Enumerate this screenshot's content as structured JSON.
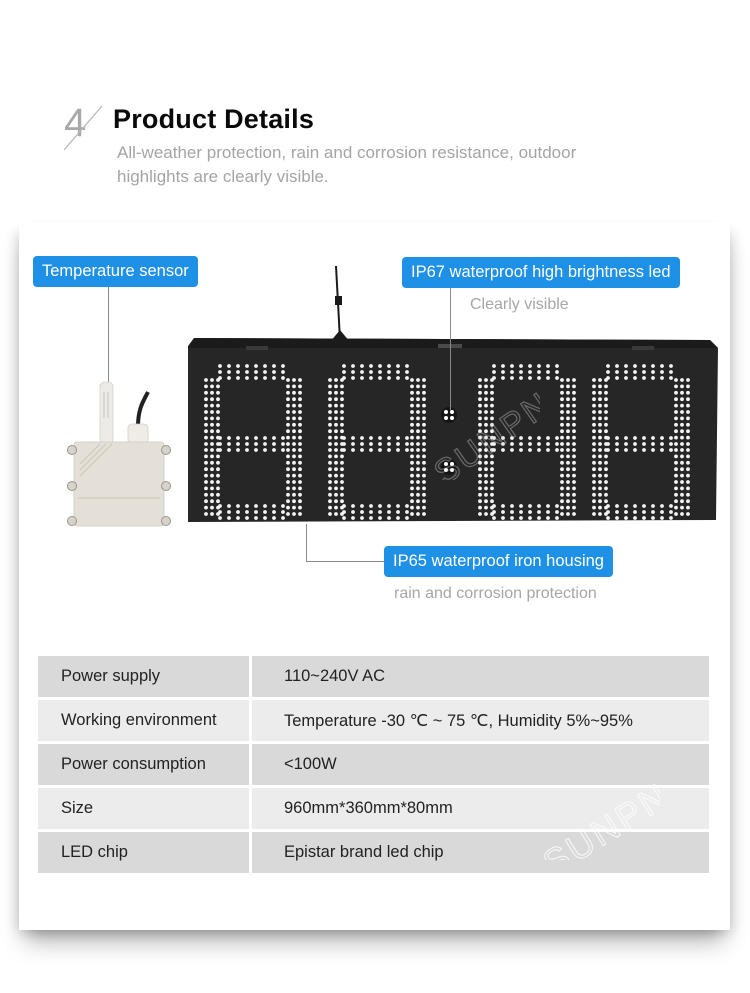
{
  "header": {
    "step_number": "4",
    "title": "Product Details",
    "subtitle": "All-weather protection, rain and corrosion resistance, outdoor highlights are clearly visible."
  },
  "callouts": {
    "sensor": {
      "label": "Temperature sensor"
    },
    "led": {
      "label": "IP67 waterproof high brightness led",
      "caption": "Clearly visible"
    },
    "housing": {
      "label": "IP65 waterproof iron housing",
      "caption": "rain and corrosion protection"
    }
  },
  "display": {
    "digits": [
      "8",
      "8",
      "8",
      "8"
    ],
    "watermark": "SUNPN"
  },
  "colors": {
    "badge": "#1e90e6",
    "row_dark": "#d9d9d9",
    "row_light": "#ececec"
  },
  "specs": [
    {
      "label": "Power supply",
      "value": "110~240V AC"
    },
    {
      "label": "Working environment",
      "value": "Temperature -30 ℃ ~ 75 ℃,  Humidity 5%~95%"
    },
    {
      "label": "Power consumption",
      "value": "<100W"
    },
    {
      "label": "Size",
      "value": "960mm*360mm*80mm"
    },
    {
      "label": "LED chip",
      "value": "Epistar brand led chip"
    }
  ]
}
